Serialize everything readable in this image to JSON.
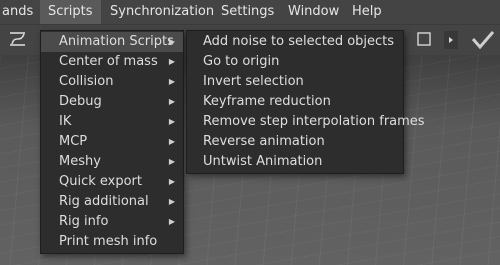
{
  "menubar": {
    "items": [
      {
        "label": "ands"
      },
      {
        "label": "Scripts"
      },
      {
        "label": "Synchronization"
      },
      {
        "label": "Settings"
      },
      {
        "label": "Window"
      },
      {
        "label": "Help"
      }
    ]
  },
  "toolbar": {
    "icons": [
      "curve-tool-icon",
      "square-icon",
      "expand-arrow-icon",
      "checkmark-icon"
    ]
  },
  "scripts_menu": {
    "items": [
      {
        "label": "Animation Scripts",
        "submenu": true
      },
      {
        "label": "Center of mass",
        "submenu": true
      },
      {
        "label": "Collision",
        "submenu": true
      },
      {
        "label": "Debug",
        "submenu": true
      },
      {
        "label": "IK",
        "submenu": true
      },
      {
        "label": "MCP",
        "submenu": true
      },
      {
        "label": "Meshy",
        "submenu": true
      },
      {
        "label": "Quick export",
        "submenu": true
      },
      {
        "label": "Rig additional",
        "submenu": true
      },
      {
        "label": "Rig info",
        "submenu": true
      },
      {
        "label": "Print mesh info",
        "submenu": false
      }
    ]
  },
  "animation_scripts_menu": {
    "items": [
      {
        "label": "Add noise to selected objects"
      },
      {
        "label": "Go to origin"
      },
      {
        "label": "Invert selection"
      },
      {
        "label": "Keyframe reduction"
      },
      {
        "label": "Remove step interpolation frames"
      },
      {
        "label": "Reverse animation"
      },
      {
        "label": "Untwist Animation"
      }
    ]
  },
  "colors": {
    "menubar_bg": "#444444",
    "menu_bg": "#2d2d2d",
    "highlight": "#4b4b4b",
    "text": "#dedede"
  }
}
